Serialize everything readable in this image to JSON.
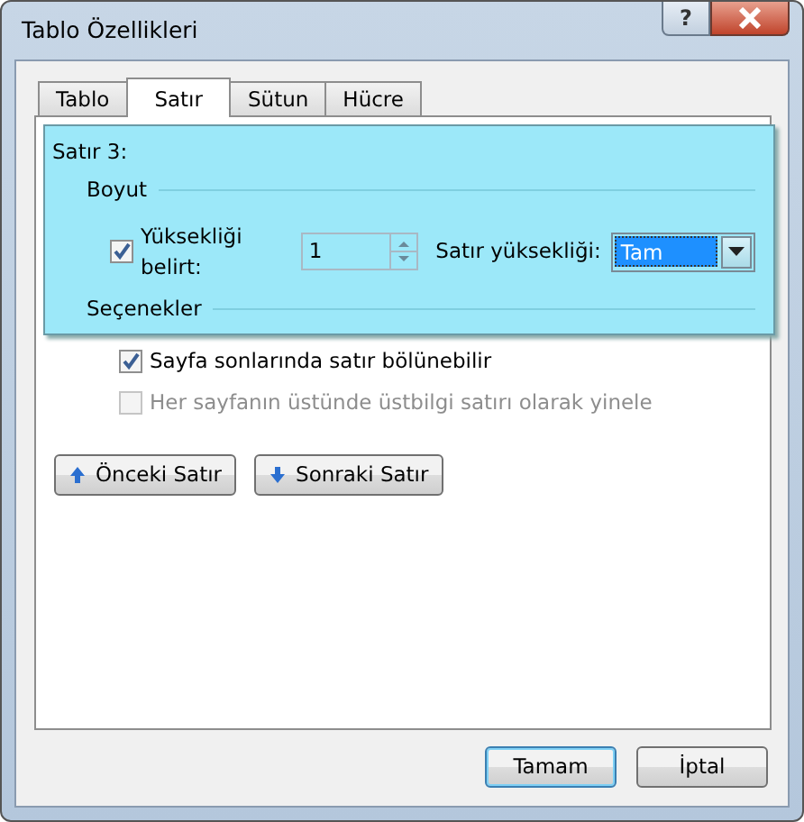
{
  "window": {
    "title": "Tablo Özellikleri",
    "help_button": "?"
  },
  "tabs": [
    {
      "label": "Tablo",
      "selected": false
    },
    {
      "label": "Satır",
      "selected": true
    },
    {
      "label": "Sütun",
      "selected": false
    },
    {
      "label": "Hücre",
      "selected": false
    }
  ],
  "row_label": "Satır 3:",
  "size_section": {
    "heading": "Boyut",
    "specify_height": {
      "label": "Yüksekliği belirt:",
      "checked": true
    },
    "height_value": "1",
    "row_height_label": "Satır yüksekliği:",
    "row_height_value": "Tam"
  },
  "options_section": {
    "heading": "Seçenekler",
    "options": [
      {
        "label": "Sayfa sonlarında satır bölünebilir",
        "checked": true,
        "disabled": false
      },
      {
        "label": "Her sayfanın üstünde üstbilgi satırı olarak yinele",
        "checked": false,
        "disabled": true
      }
    ]
  },
  "nav_buttons": [
    {
      "label": "Önceki Satır",
      "kind": "up"
    },
    {
      "label": "Sonraki Satır",
      "kind": "down"
    }
  ],
  "footer_buttons": [
    {
      "label": "Tamam",
      "default": true
    },
    {
      "label": "İptal",
      "default": false
    }
  ]
}
